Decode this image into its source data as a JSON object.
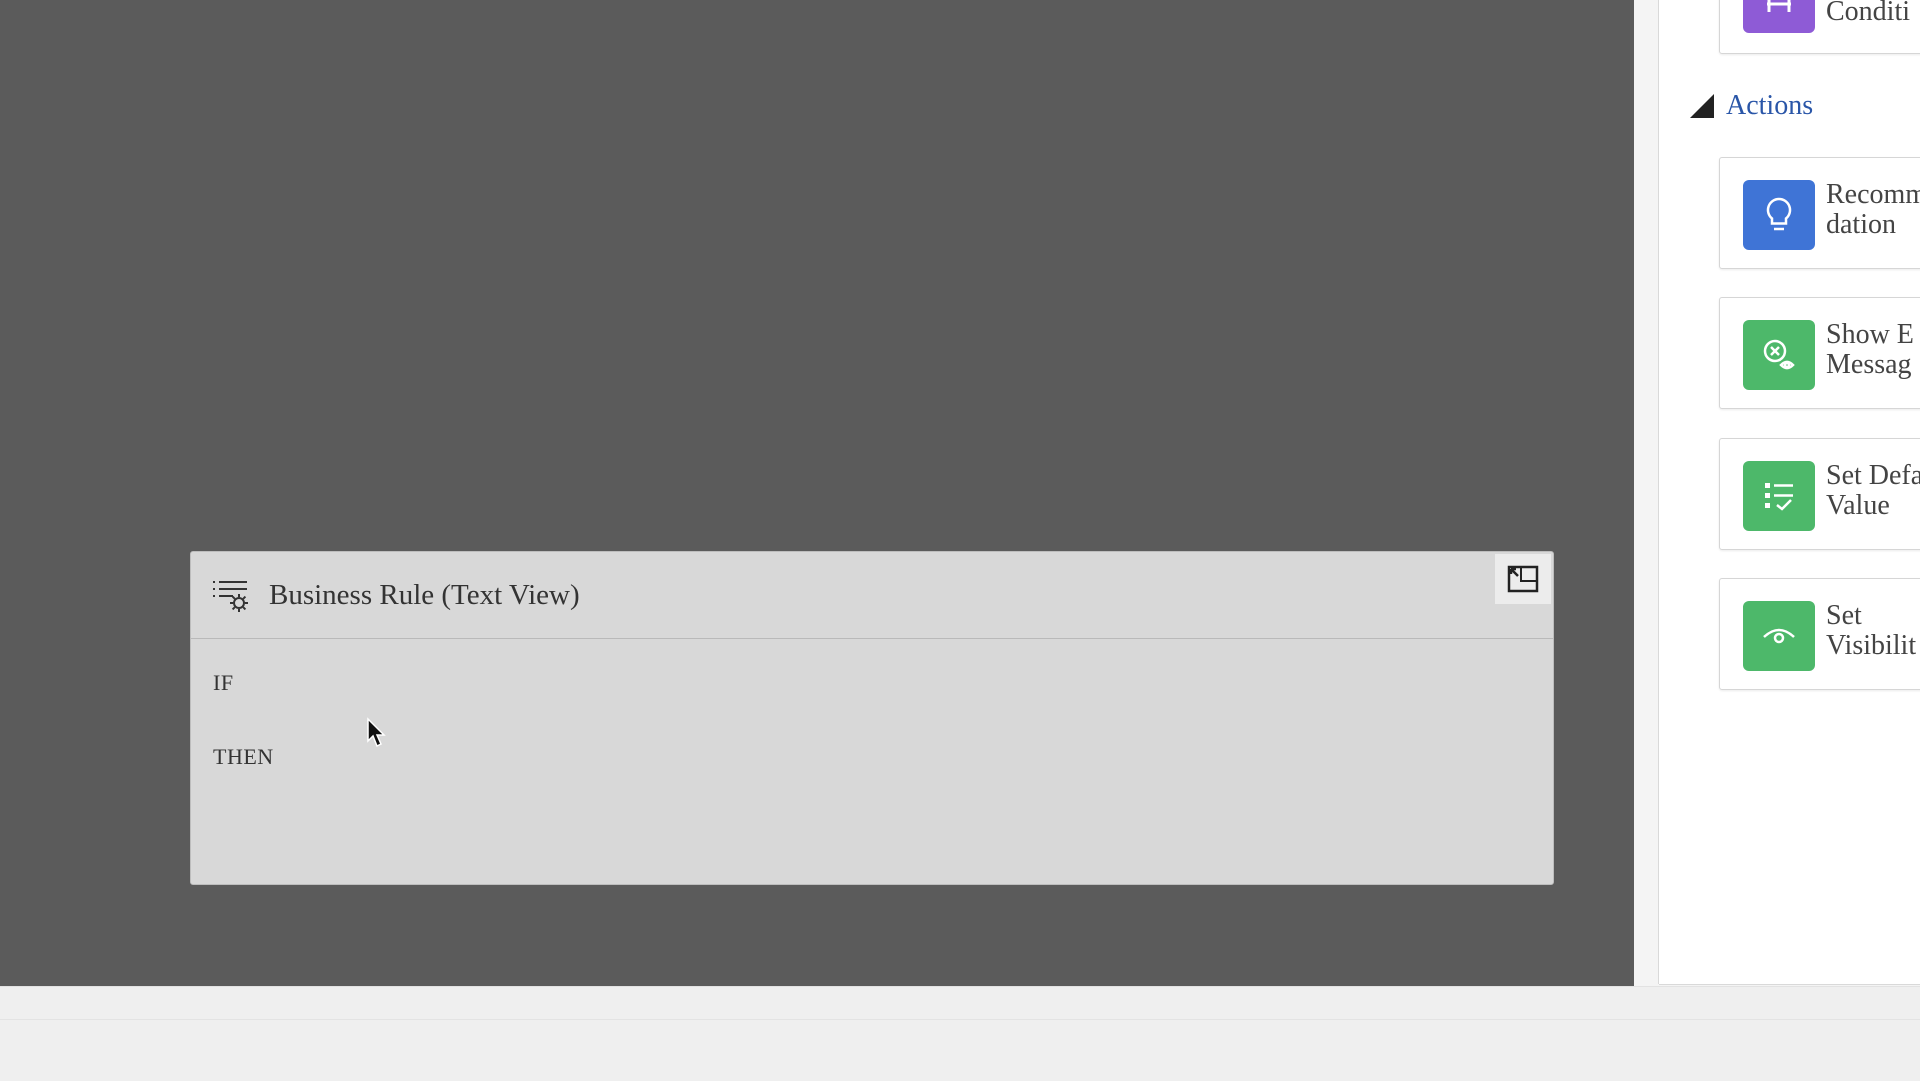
{
  "rule_panel": {
    "title": "Business Rule (Text View)",
    "if_label": "IF",
    "then_label": "THEN",
    "icon": "rule-settings-icon",
    "expand_icon": "expand-icon"
  },
  "sidebar": {
    "top_tile": {
      "label": "Conditi",
      "icon": "condition-icon",
      "color": "#8e5bd6"
    },
    "actions_header": "Actions",
    "actions": [
      {
        "label": "Recomm\ndation",
        "icon": "lightbulb-icon",
        "color": "#3f74d6"
      },
      {
        "label": "Show E\nMessag",
        "icon": "error-message-icon",
        "color": "#4db86a"
      },
      {
        "label": "Set Defa\nValue",
        "icon": "default-value-icon",
        "color": "#4db86a"
      },
      {
        "label": "Set\nVisibilit",
        "icon": "visibility-eye-icon",
        "color": "#4db86a"
      }
    ]
  }
}
